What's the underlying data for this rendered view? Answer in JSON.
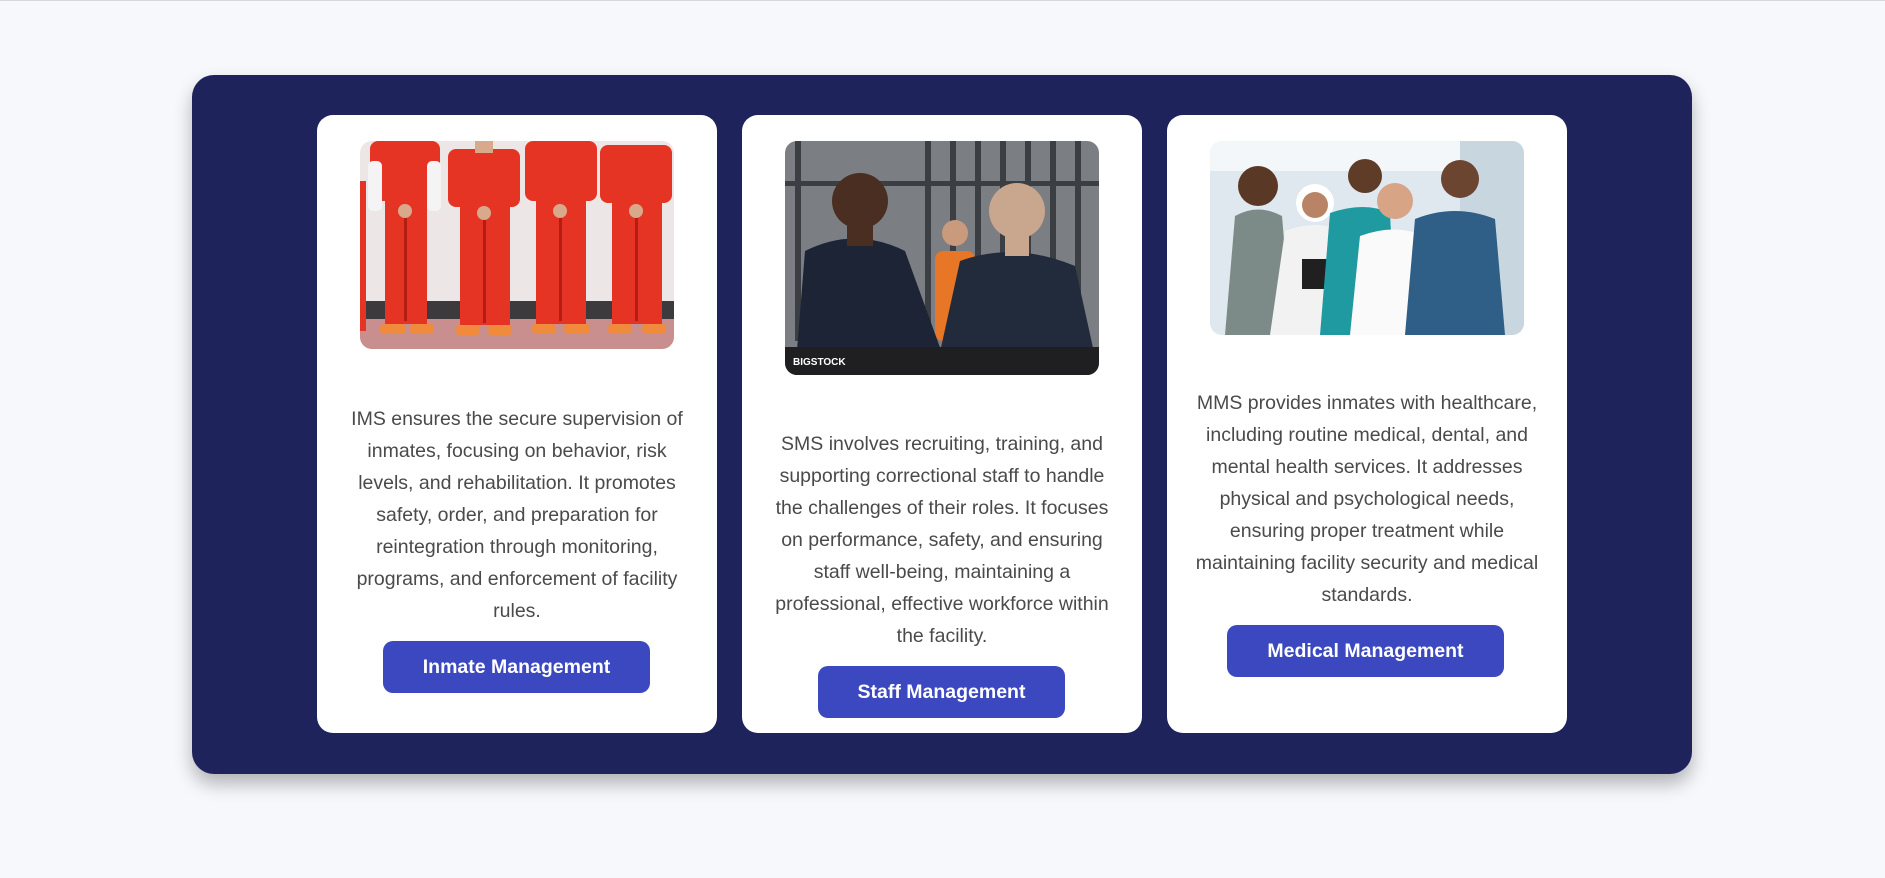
{
  "cards": [
    {
      "image_alt": "Inmates in orange jumpsuits",
      "description": "IMS ensures the secure supervision of inmates, focusing on behavior, risk levels, and rehabilitation. It promotes safety, order, and preparation for reintegration through monitoring, programs, and enforcement of facility rules.",
      "button_label": "Inmate Management"
    },
    {
      "image_alt": "Correctional officers in a prison",
      "image_watermark": "BIGSTOCK",
      "description": "SMS involves recruiting, training, and supporting correctional staff to handle the challenges of their roles. It focuses on performance, safety, and ensuring staff well-being, maintaining a professional, effective workforce within the facility.",
      "button_label": "Staff Management"
    },
    {
      "image_alt": "Medical team",
      "description": "MMS provides inmates with healthcare, including routine medical, dental, and mental health services. It addresses physical and psychological needs, ensuring proper treatment while maintaining facility security and medical standards.",
      "button_label": "Medical Management"
    }
  ],
  "colors": {
    "page_background": "#f7f8fc",
    "panel_background": "#1f235c",
    "card_background": "#ffffff",
    "button_background": "#3b48bf",
    "button_text": "#ffffff",
    "description_text": "#4a4a4a"
  }
}
